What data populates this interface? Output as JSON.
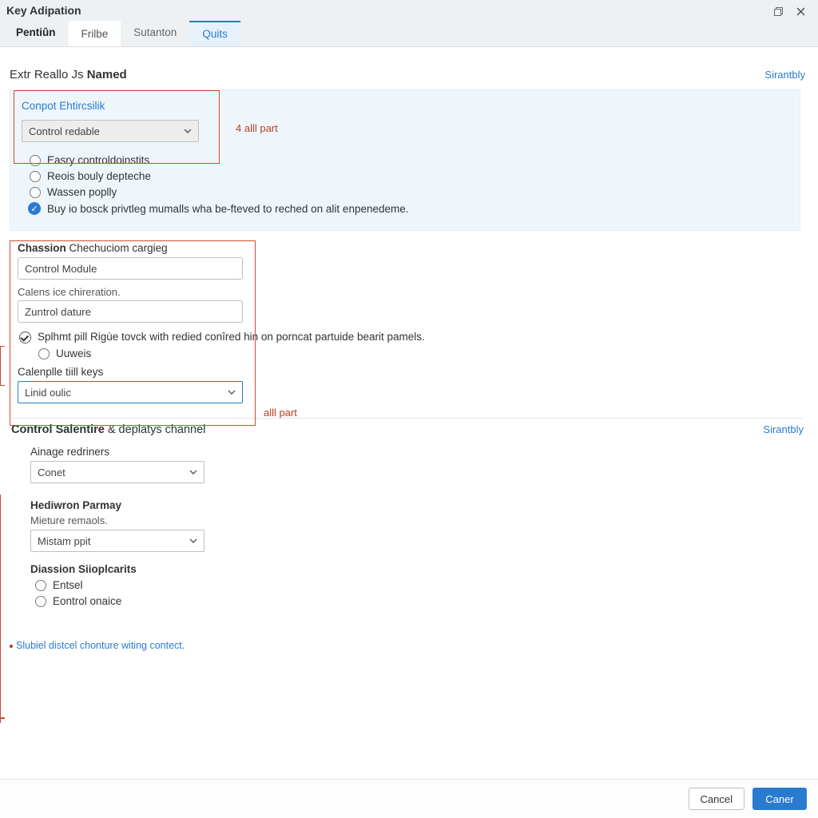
{
  "window": {
    "title": "Key Adipation"
  },
  "tabs": [
    {
      "label": "Pentiûn"
    },
    {
      "label": "Frilbe"
    },
    {
      "label": "Sutanton"
    },
    {
      "label": "Quits"
    }
  ],
  "section1": {
    "title_pre": "Extr Reallo Js ",
    "title_bold": "Named",
    "link": "Sirantbly",
    "card": {
      "title": "Conpot Ehtircsilik",
      "select_value": "Control redable",
      "radios": [
        "Easry controldoinstits",
        "Reois bouly depteche",
        "Wassen poplly"
      ],
      "info_line": "Buy io bosck privtleg mumalls wha be-fteved to reched on alit enpenedeme."
    },
    "chassion": {
      "label_bold": "Chassion",
      "label_rest": " Chechuciom cargieg",
      "value1": "Control Module",
      "label2": "Calens ice chireration.",
      "value2": "Zuntrol dature",
      "check_text": "Splhmt pill Rigùe tovck with redied conîred hin on porncat partuide bearit pamels.",
      "sub_radio": "Uuweis",
      "keys_label": "Calenplle tiill keys",
      "keys_value": "Linid oulic"
    }
  },
  "section2": {
    "title_bold": "Control Salentire",
    "title_rest": " & deplatys channel",
    "link": "Sirantbly",
    "ainage": {
      "label": "Ainage redriners",
      "value": "Conet"
    },
    "hediwron": {
      "label": "Hediwron Parmay",
      "sublabel": "Mieture remaols.",
      "value": "Mistam ppit"
    },
    "diassion": {
      "label": "Diassion Siioplcarits",
      "radios": [
        "Entsel",
        "Eontrol onaice"
      ]
    }
  },
  "annotations": {
    "a1": "4 alll part",
    "a2": "alll part"
  },
  "footnote": "Slubiel distcel chonture witing contect.",
  "footer": {
    "cancel": "Cancel",
    "ok": "Caner"
  }
}
